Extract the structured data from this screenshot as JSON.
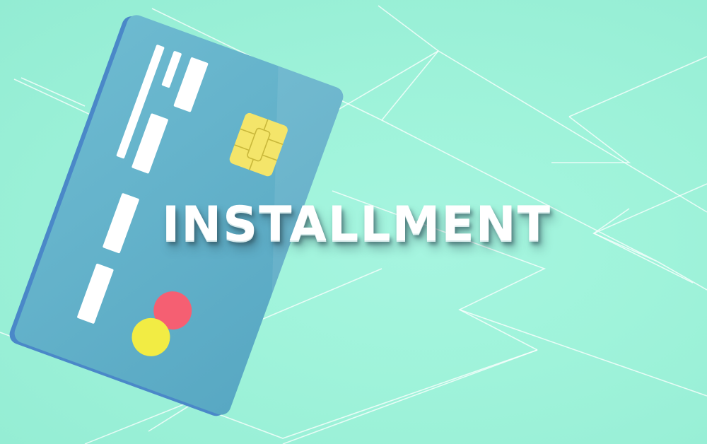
{
  "headline": "INSTALLMENT",
  "colors": {
    "background": "#9ff3da",
    "card": "#5fb0c8",
    "card_edge": "#4a8fc4",
    "chip": "#f4e56a",
    "logo_circle_top": "#f55f72",
    "logo_circle_bottom": "#f2ec44",
    "stripes": "#ffffff",
    "lines": "#ffffff"
  },
  "icons": [
    "credit-card-icon",
    "chip-icon",
    "card-brand-logo-icon"
  ]
}
